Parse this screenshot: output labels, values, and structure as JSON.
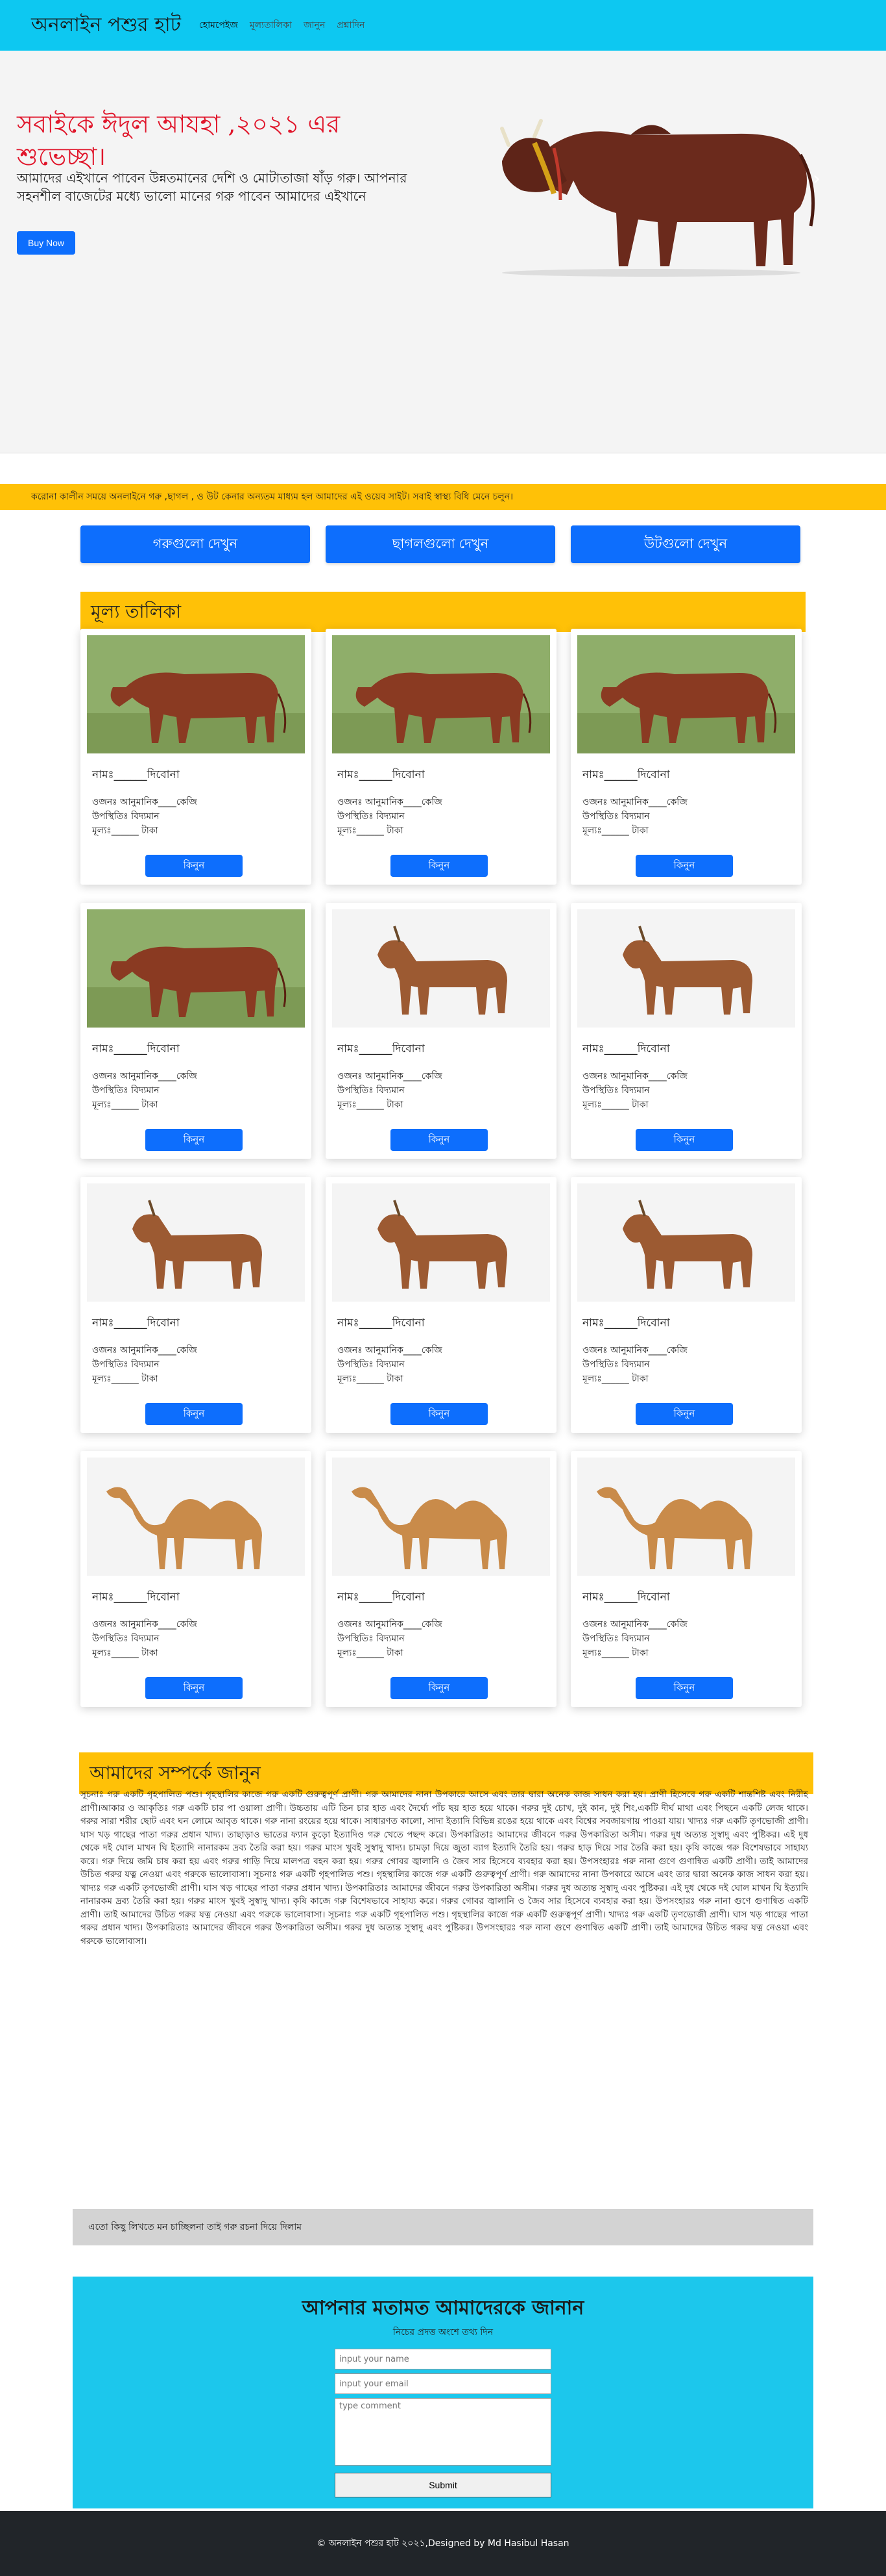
{
  "nav": {
    "brand": "অনলাইন পশুর হাট",
    "links": [
      "হোমপেইজ",
      "মূল্যতালিকা",
      "জানুন",
      "প্রশ্নাদিন"
    ]
  },
  "hero": {
    "title": "সবাইকে ঈদুল আযহা ,২০২১ এর শুভেচ্ছা।",
    "subtitle": "আমাদের এইখানে পাবেন উন্নতমানের দেশি ও মোটাতাজা ষাঁড় গরু। আপনার সহনশীল বাজেটের মধ্যে ভালো মানের গরু পাবেন আমাদের এইখানে",
    "buy_label": "Buy Now",
    "next_icon": "›"
  },
  "marquee": "করোনা কালীন সময়ে অনলাইনে গরু ,ছাগল , ও উট কেনার অন্যতম মাধ্যম হল আমাদের এই ওয়েব সাইট। সবাই স্বাস্থ্য বিধি মেনে চলুন।",
  "categories": [
    "গরুগুলো দেখুন",
    "ছাগলগুলো দেখুন",
    "উটগুলো দেখুন"
  ],
  "price_section": {
    "title": "মূল্য তালিকা"
  },
  "card_text": {
    "name": "নামঃ______দিবোনা",
    "weight": "ওজনঃ আনুমানিক____কেজি",
    "presence": "উপস্থিতিঃ বিদ্যমান",
    "price": "মূল্যঃ______ টাকা",
    "buy": "কিনুন"
  },
  "products": [
    {
      "animal": "cow"
    },
    {
      "animal": "cow"
    },
    {
      "animal": "cow"
    },
    {
      "animal": "cow"
    },
    {
      "animal": "goat"
    },
    {
      "animal": "goat"
    },
    {
      "animal": "goat"
    },
    {
      "animal": "goat"
    },
    {
      "animal": "goat"
    },
    {
      "animal": "camel"
    },
    {
      "animal": "camel"
    },
    {
      "animal": "camel"
    }
  ],
  "about": {
    "title": "আমাদের সম্পর্কে জানুন",
    "text": "সূচনাঃ গরু একটি গৃহপালিত পশু। গৃহস্থালির কাজে গরু একটি গুরুত্বপূর্ণ প্রাণী। গরু আমাদের নানা উপকারে আসে এবং তার দ্বারা অনেক কাজ সাধন করা হয়। প্রাণী হিসেবে গরু একটি শান্তশিষ্ট এবং নিরীহ প্রাণী।আকার ও আকৃতিঃ গরু একটি চার পা ওয়ালা প্রাণী। উচ্চতায় এটি তিন চার হাত এবং দৈর্ঘ্যে পাঁচ ছয় হাত হয়ে থাকে। গরুর দুই চোখ, দুই কান, দুই শিং,একটি দীর্ঘ মাথা এবং পিছনে একটি লেজ থাকে। গরুর সারা শরীর ছোট এবং ঘন লোমে আবৃত থাকে। গরু নানা রংয়ের হয়ে থাকে। সাধারণত কালো, সাদা ইত্যাদি বিভিন্ন রঙের হয়ে থাকে এবং বিশ্বের সবজায়গায় পাওয়া যায়। খাদ্যঃ গরু একটি তৃণভোজী প্রাণী। ঘাস খড় গাছের পাতা গরুর প্রধান খাদ্য। তাছাড়াও ভাতের ফ্যান কুড়ো ইত্যাদিও গরু খেতে পছন্দ করে। উপকারিতাঃ আমাদের জীবনে গরুর উপকারিতা অসীম। গরুর দুধ অত্যন্ত সুস্বাদু এবং পুষ্টিকর। এই দুধ থেকে দই ঘোল মাখন ঘি ইত্যাদি নানারকম দ্রব্য তৈরি করা হয়। গরুর মাংস খুবই সুস্বাদু খাদ্য। চামড়া দিয়ে জুতা ব্যাগ ইত্যাদি তৈরি হয়। গরুর হাড় দিয়ে সার তৈরি করা হয়। কৃষি কাজে গরু বিশেষভাবে সাহায্য করে। গরু দিয়ে জমি চাষ করা হয় এবং গরুর গাড়ি দিয়ে মালপত্র বহন করা হয়। গরুর গোবর জ্বালানি ও জৈব সার হিসেবে ব্যবহার করা হয়। উপসংহারঃ গরু নানা গুণে গুণান্বিত একটি প্রাণী। তাই আমাদের উচিত গরুর যত্ন নেওয়া এবং গরুকে ভালোবাসা। সূচনাঃ গরু একটি গৃহপালিত পশু। গৃহস্থালির কাজে গরু একটি গুরুত্বপূর্ণ প্রাণী। গরু আমাদের নানা উপকারে আসে এবং তার দ্বারা অনেক কাজ সাধন করা হয়। খাদ্যঃ গরু একটি তৃণভোজী প্রাণী। ঘাস খড় গাছের পাতা গরুর প্রধান খাদ্য। উপকারিতাঃ আমাদের জীবনে গরুর উপকারিতা অসীম। গরুর দুধ অত্যন্ত সুস্বাদু এবং পুষ্টিকর। এই দুধ থেকে দই ঘোল মাখন ঘি ইত্যাদি নানারকম দ্রব্য তৈরি করা হয়। গরুর মাংস খুবই সুস্বাদু খাদ্য। কৃষি কাজে গরু বিশেষভাবে সাহায্য করে। গরুর গোবর জ্বালানি ও জৈব সার হিসেবে ব্যবহার করা হয়। উপসংহারঃ গরু নানা গুণে গুণান্বিত একটি প্রাণী। তাই আমাদের উচিত গরুর যত্ন নেওয়া এবং গরুকে ভালোবাসা। সূচনাঃ গরু একটি গৃহপালিত পশু। গৃহস্থালির কাজে গরু একটি গুরুত্বপূর্ণ প্রাণী। খাদ্যঃ গরু একটি তৃণভোজী প্রাণী। ঘাস খড় গাছের পাতা গরুর প্রধান খাদ্য। উপকারিতাঃ আমাদের জীবনে গরুর উপকারিতা অসীম। গরুর দুধ অত্যন্ত সুস্বাদু এবং পুষ্টিকর। উপসংহারঃ গরু নানা গুণে গুণান্বিত একটি প্রাণী। তাই আমাদের উচিত গরুর যত্ন নেওয়া এবং গরুকে ভালোবাসা।"
  },
  "note": "এতো কিছু লিখতে মন চাচ্ছিলনা তাই গরু রচনা দিয়ে দিলাম",
  "feedback": {
    "title": "আপনার মতামত আমাদেরকে জানান",
    "subtitle": "নিচের প্রদত্ত অংশে তথ্য দিন",
    "name_placeholder": "input your name",
    "email_placeholder": "input your email",
    "comment_placeholder": "type comment",
    "submit_label": "Submit"
  },
  "footer": "© অনলাইন পশুর হাট ২০২১,Designed by Md Hasibul Hasan",
  "colors": {
    "nav": "#0dc8f1",
    "accent": "#0d6efd",
    "highlight": "#ffc107",
    "hero_title": "#e0162b",
    "footer": "#212529"
  }
}
